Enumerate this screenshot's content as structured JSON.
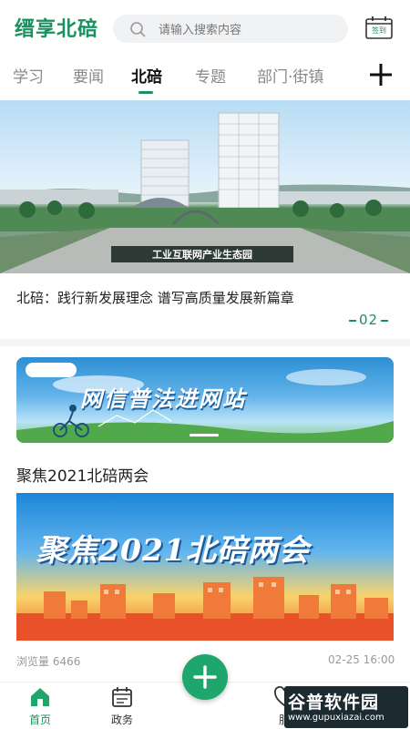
{
  "header": {
    "logo": "缙享北碚",
    "search_placeholder": "请输入搜索内容",
    "checkin_label": "签到"
  },
  "tabs": [
    {
      "label": "学习",
      "active": false
    },
    {
      "label": "要闻",
      "active": false
    },
    {
      "label": "北碚",
      "active": true
    },
    {
      "label": "专题",
      "active": false
    },
    {
      "label": "部门·街镇",
      "active": false
    }
  ],
  "hero": {
    "sign_text": "工业互联网产业生态园",
    "caption": "北碚：践行新发展理念 谱写高质量发展新篇章",
    "index": "02"
  },
  "ad_banner": {
    "title": "网信普法进网站"
  },
  "section": {
    "title": "聚焦2021北碚两会",
    "image_title": "聚焦2021北碚两会",
    "views": "浏览量 6466",
    "time": "02-25 16:00"
  },
  "bottom_nav": {
    "items": [
      {
        "label": "首页",
        "icon": "home-icon",
        "active": true
      },
      {
        "label": "政务",
        "icon": "calendar-icon",
        "active": false
      },
      {
        "label": "服",
        "icon": "service-icon",
        "active": false
      }
    ]
  },
  "watermark": {
    "title": "谷普软件园",
    "subtitle": "www.gupuxiazai.com"
  },
  "colors": {
    "brand": "#1a9160",
    "fab": "#1fa66d"
  }
}
